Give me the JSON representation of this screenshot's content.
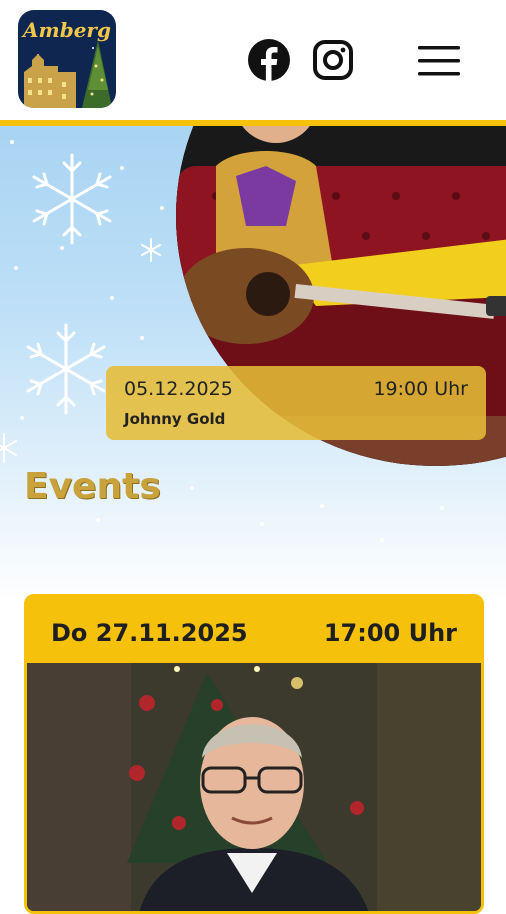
{
  "header": {
    "logo_text": "Amberg",
    "icons": [
      "facebook-icon",
      "instagram-icon",
      "menu-icon"
    ]
  },
  "hero": {
    "date": "05.12.2025",
    "time": "19:00 Uhr",
    "artist": "Johnny Gold"
  },
  "events": {
    "heading": "Events",
    "cards": [
      {
        "date": "Do 27.11.2025",
        "time": "17:00 Uhr"
      }
    ]
  },
  "colors": {
    "accent": "#f5c10a",
    "heading": "#c9a23c",
    "sky": "#a9d4f2"
  }
}
